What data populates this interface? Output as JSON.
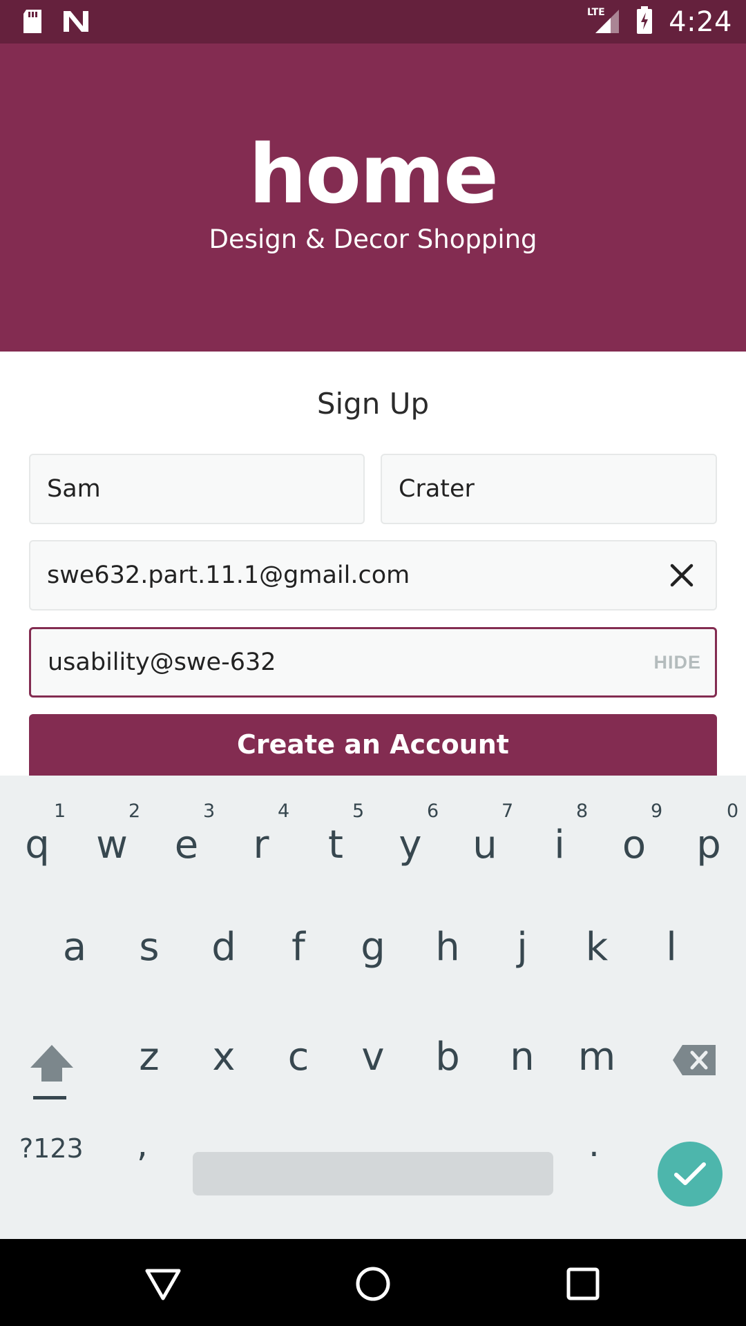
{
  "status_bar": {
    "time": "4:24",
    "network": "LTE",
    "icons": [
      "sd-card-icon",
      "n-notification-icon",
      "lte-signal-icon",
      "battery-charging-icon"
    ]
  },
  "header": {
    "logo_text": "home",
    "tagline": "Design & Decor Shopping",
    "background_color": "#832c51"
  },
  "form": {
    "title": "Sign Up",
    "first_name": "Sam",
    "last_name": "Crater",
    "email": "swe632.part.11.1@gmail.com",
    "password": "usability@swe-632",
    "hide_label": "HIDE",
    "submit_label": "Create an Account"
  },
  "keyboard": {
    "row1": [
      {
        "letter": "q",
        "hint": "1"
      },
      {
        "letter": "w",
        "hint": "2"
      },
      {
        "letter": "e",
        "hint": "3"
      },
      {
        "letter": "r",
        "hint": "4"
      },
      {
        "letter": "t",
        "hint": "5"
      },
      {
        "letter": "y",
        "hint": "6"
      },
      {
        "letter": "u",
        "hint": "7"
      },
      {
        "letter": "i",
        "hint": "8"
      },
      {
        "letter": "o",
        "hint": "9"
      },
      {
        "letter": "p",
        "hint": "0"
      }
    ],
    "row2": [
      "a",
      "s",
      "d",
      "f",
      "g",
      "h",
      "j",
      "k",
      "l"
    ],
    "row3": [
      "z",
      "x",
      "c",
      "v",
      "b",
      "n",
      "m"
    ],
    "symbols_label": "?123",
    "comma": ",",
    "period": ".",
    "accent_color": "#4db6ac"
  },
  "nav_bar": {
    "buttons": [
      "back-icon",
      "home-icon",
      "recents-icon"
    ]
  }
}
